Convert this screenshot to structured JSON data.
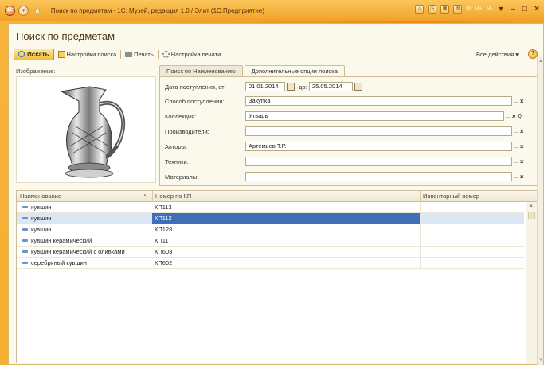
{
  "titlebar": {
    "logo": "1С",
    "title": "Поиск по предметам - 1С: Музей, редакция 1.0 / Элит (1С:Предприятие)",
    "m_buttons": [
      "M",
      "M+",
      "M-"
    ],
    "icons": [
      "home-icon",
      "history-icon",
      "calc-icon",
      "calendar-icon"
    ]
  },
  "page": {
    "title": "Поиск по предметам"
  },
  "toolbar": {
    "search_label": "Искать",
    "search_settings_label": "Настройки поиска",
    "print_label": "Печать",
    "print_settings_label": "Настройка печати",
    "all_actions_label": "Все действия ▾",
    "help_label": "?"
  },
  "image_section": {
    "label": "Изображение:"
  },
  "tabs": [
    {
      "label": "Поиск по Наименованию",
      "active": false
    },
    {
      "label": "Дополнительные опции поиска",
      "active": true
    }
  ],
  "form": {
    "date_label": "Дата поступления, от:",
    "date_from": "01.01.2014",
    "date_to_label": "до:",
    "date_to": "25.05.2014",
    "fields": [
      {
        "label": "Способ поступления:",
        "value": "Закупка"
      },
      {
        "label": "Коллекция:",
        "value": "Утварь"
      },
      {
        "label": "Производители:",
        "value": ""
      },
      {
        "label": "Авторы:",
        "value": "Артемьев Т.Р."
      },
      {
        "label": "Техники:",
        "value": ""
      },
      {
        "label": "Материалы:",
        "value": ""
      }
    ],
    "dots": "...",
    "clear": "×",
    "search": "Q"
  },
  "table": {
    "columns": [
      "Наименование",
      "Номер по КП",
      "Инвентарный номер"
    ],
    "rows": [
      {
        "name": "кувшин",
        "kp": "КП113",
        "inv": ""
      },
      {
        "name": "кувшин",
        "kp": "КП112",
        "inv": ""
      },
      {
        "name": "кувшин",
        "kp": "КП128",
        "inv": ""
      },
      {
        "name": "кувшин керамический",
        "kp": "КП11",
        "inv": ""
      },
      {
        "name": "кувшин керамический с оливками",
        "kp": "КП603",
        "inv": ""
      },
      {
        "name": "серебряный кувшин",
        "kp": "КП602",
        "inv": ""
      }
    ],
    "selected_row": 1
  },
  "colors": {
    "accent": "#f0a22a",
    "selection": "#3f6fb8",
    "selection_light": "#dbe7f4"
  }
}
